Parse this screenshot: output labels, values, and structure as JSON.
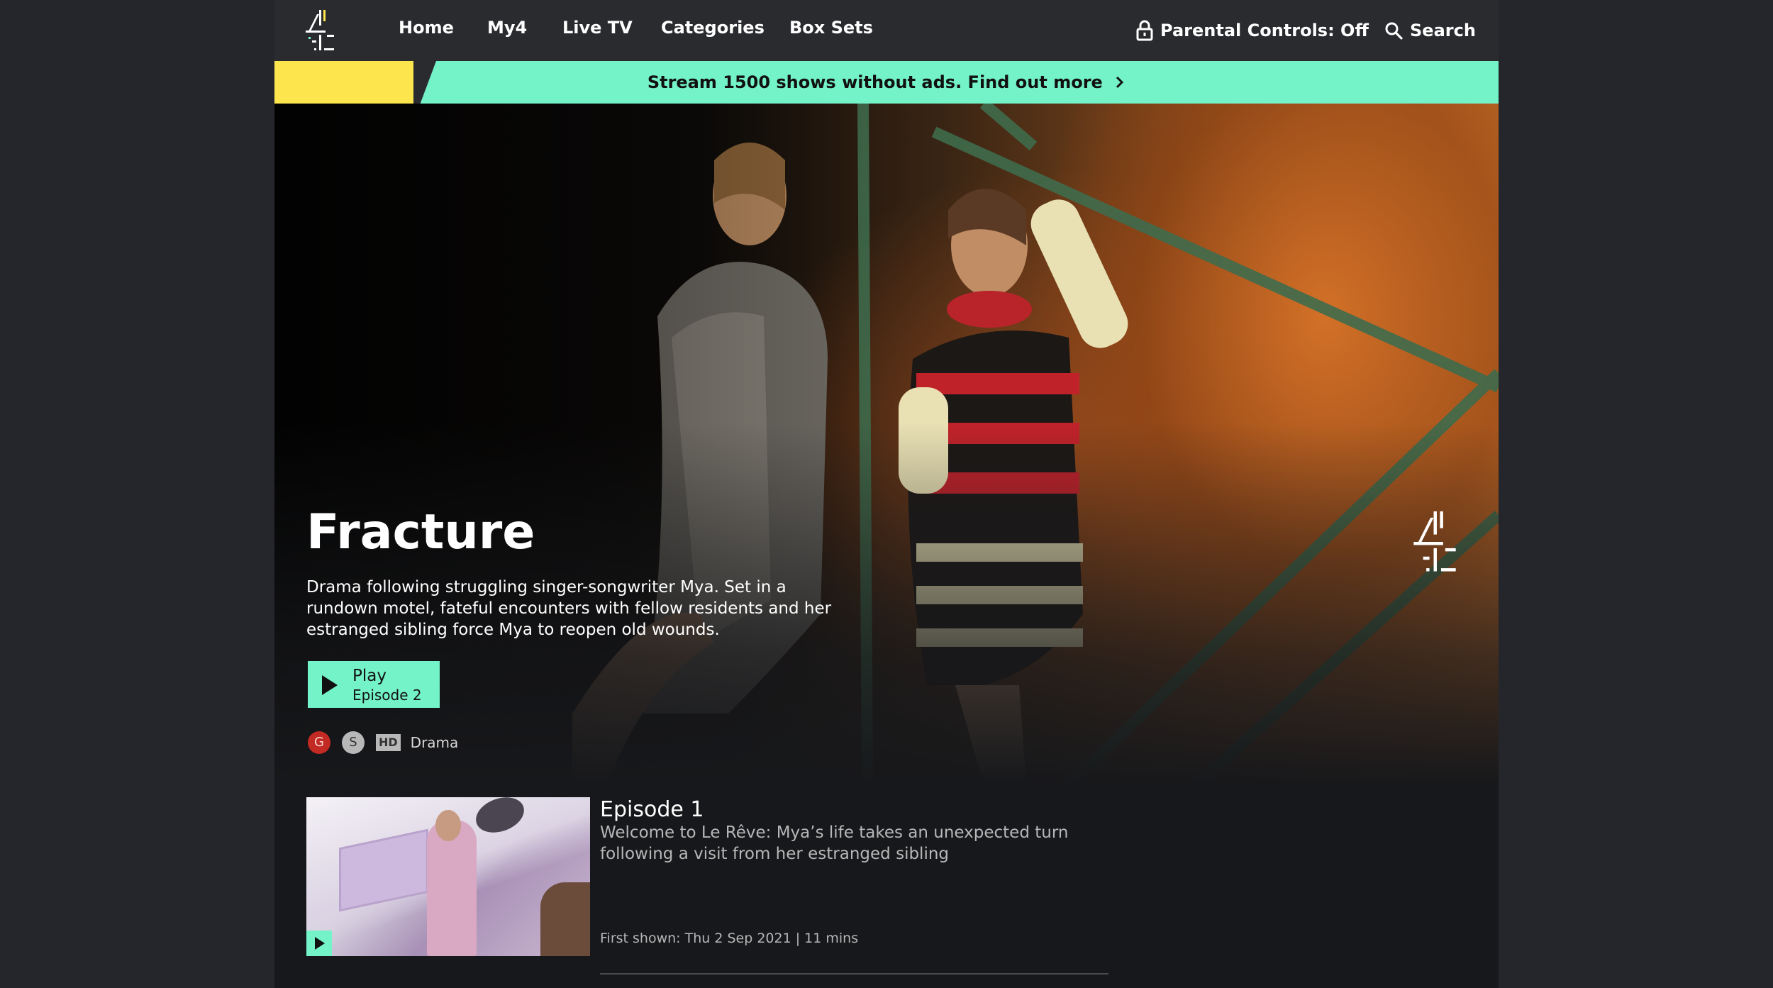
{
  "nav": {
    "items": [
      "Home",
      "My4",
      "Live TV",
      "Categories",
      "Box Sets"
    ],
    "parental_controls": "Parental Controls: Off",
    "search": "Search"
  },
  "promo": {
    "text": "Stream 1500 shows without ads. Find out more",
    "colors": {
      "banner": "#74f2c8",
      "accent": "#fde54e"
    }
  },
  "hero": {
    "title": "Fracture",
    "description": "Drama following struggling singer-songwriter Mya. Set in a rundown motel, fateful encounters with fellow residents and her estranged sibling force Mya to reopen old wounds.",
    "play_label": "Play",
    "play_sublabel": "Episode 2",
    "badges": {
      "rating": "G",
      "subtitles": "S",
      "quality": "HD",
      "genre": "Drama"
    }
  },
  "episodes": [
    {
      "title": "Episode 1",
      "description": "Welcome to Le Rêve: Mya’s life takes an unexpected turn following a visit from her estranged sibling",
      "meta": "First shown: Thu 2 Sep 2021 | 11 mins"
    }
  ],
  "icons": [
    "channel4-logo-icon",
    "padlock-icon",
    "search-icon",
    "chevron-right-icon",
    "play-icon"
  ]
}
